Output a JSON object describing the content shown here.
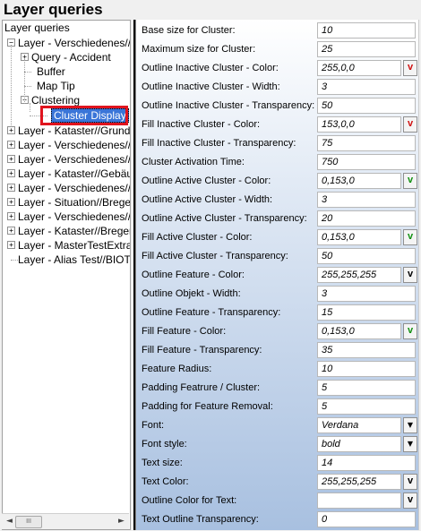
{
  "title": "Layer queries",
  "tree": {
    "header": "Layer queries",
    "items": [
      {
        "label": "Layer - Verschiedenes//",
        "expander": "−"
      },
      {
        "label": "Query - Accident",
        "expander": "+"
      },
      {
        "label": "Buffer",
        "expander": ""
      },
      {
        "label": "Map Tip",
        "expander": ""
      },
      {
        "label": "Clustering",
        "expander": "−"
      },
      {
        "label": "Cluster Display",
        "expander": ""
      },
      {
        "label": "Layer - Kataster//Grund",
        "expander": "+"
      },
      {
        "label": "Layer - Verschiedenes//",
        "expander": "+"
      },
      {
        "label": "Layer - Verschiedenes//",
        "expander": "+"
      },
      {
        "label": "Layer - Kataster//Gebäu",
        "expander": "+"
      },
      {
        "label": "Layer - Verschiedenes//",
        "expander": "+"
      },
      {
        "label": "Layer - Situation//Brege",
        "expander": "+"
      },
      {
        "label": "Layer - Verschiedenes//",
        "expander": "+"
      },
      {
        "label": "Layer - Kataster//Bregen",
        "expander": "+"
      },
      {
        "label": "Layer - MasterTestExtra",
        "expander": "+"
      },
      {
        "label": "Layer - Alias Test//BIOT",
        "expander": ""
      }
    ],
    "scrollbar": {
      "left": "◄",
      "right": "►",
      "thumb": "III"
    }
  },
  "properties": [
    {
      "label": "Base size for Cluster:",
      "value": "10",
      "control": "none"
    },
    {
      "label": "Maximum size for Cluster:",
      "value": "25",
      "control": "none"
    },
    {
      "label": "Outline Inactive Cluster - Color:",
      "value": "255,0,0",
      "control": "v-red"
    },
    {
      "label": "Outline Inactive Cluster - Width:",
      "value": "3",
      "control": "none"
    },
    {
      "label": "Outline Inactive Cluster - Transparency:",
      "value": "50",
      "control": "none"
    },
    {
      "label": "Fill Inactive Cluster - Color:",
      "value": "153,0,0",
      "control": "v-red"
    },
    {
      "label": "Fill Inactive Cluster - Transparency:",
      "value": "75",
      "control": "none"
    },
    {
      "label": "Cluster Activation Time:",
      "value": "750",
      "control": "none"
    },
    {
      "label": "Outline Active Cluster - Color:",
      "value": "0,153,0",
      "control": "v-green"
    },
    {
      "label": "Outline Active Cluster - Width:",
      "value": "3",
      "control": "none"
    },
    {
      "label": "Outline Active Cluster - Transparency:",
      "value": "20",
      "control": "none"
    },
    {
      "label": "Fill Active Cluster - Color:",
      "value": "0,153,0",
      "control": "v-green"
    },
    {
      "label": "Fill Active Cluster - Transparency:",
      "value": "50",
      "control": "none"
    },
    {
      "label": "Outline Feature - Color:",
      "value": "255,255,255",
      "control": "v-plain"
    },
    {
      "label": "Outline Objekt - Width:",
      "value": "3",
      "control": "none"
    },
    {
      "label": "Outline Feature - Transparency:",
      "value": "15",
      "control": "none"
    },
    {
      "label": "Fill Feature - Color:",
      "value": "0,153,0",
      "control": "v-green"
    },
    {
      "label": "Fill Feature - Transparency:",
      "value": "35",
      "control": "none"
    },
    {
      "label": "Feature Radius:",
      "value": "10",
      "control": "none"
    },
    {
      "label": "Padding Featrure / Cluster:",
      "value": "5",
      "control": "none"
    },
    {
      "label": "Padding for Feature Removal:",
      "value": "5",
      "control": "none"
    },
    {
      "label": "Font:",
      "value": "Verdana",
      "control": "dropdown"
    },
    {
      "label": "Font style:",
      "value": "bold",
      "control": "dropdown"
    },
    {
      "label": "Text size:",
      "value": "14",
      "control": "none"
    },
    {
      "label": "Text Color:",
      "value": "255,255,255",
      "control": "v-plain"
    },
    {
      "label": "Outline Color for Text:",
      "value": "",
      "control": "v-plain"
    },
    {
      "label": "Text Outline Transparency:",
      "value": "0",
      "control": "none"
    }
  ],
  "button_glyphs": {
    "color_button": "v",
    "dropdown_button": "▼"
  },
  "colors": {
    "red_button": "#d01010",
    "green_button": "#109010",
    "selection": "#3a75d8",
    "highlight_box": "#e0141e"
  }
}
